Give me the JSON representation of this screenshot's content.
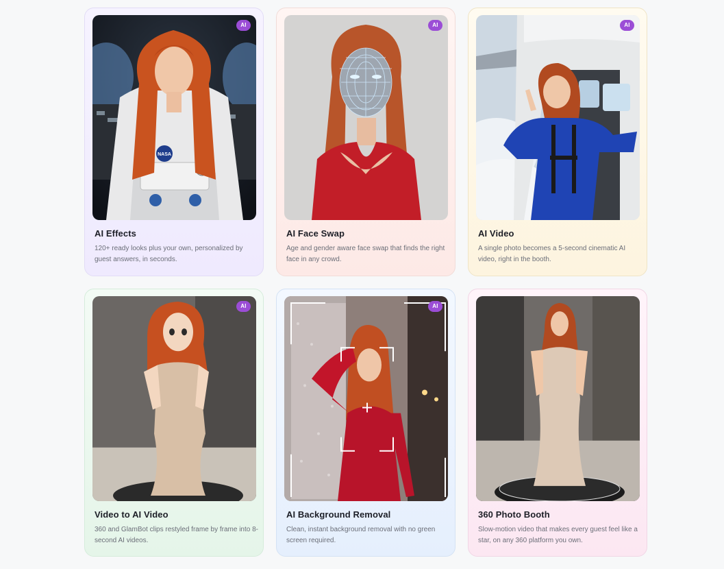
{
  "cards": [
    {
      "title": "AI Effects",
      "description": "120+ ready looks plus your own, personalized by guest answers, in seconds.",
      "badge": "AI"
    },
    {
      "title": "AI Face Swap",
      "description": "Age and gender aware face swap that finds the right face in any crowd.",
      "badge": "AI"
    },
    {
      "title": "AI Video",
      "description": "A single photo becomes a 5-second cinematic AI video, right in the booth.",
      "badge": "AI"
    },
    {
      "title": "Video to AI Video",
      "description": "360 and GlamBot clips restyled frame by frame into 8-second AI videos.",
      "badge": "AI"
    },
    {
      "title": "AI Background Removal",
      "description": "Clean, instant background removal with no green screen required.",
      "badge": "AI"
    },
    {
      "title": "360 Photo Booth",
      "description": "Slow-motion video that makes every guest feel like a star, on any 360 platform you own."
    }
  ],
  "image_labels": {
    "nasa_patch": "NASA"
  },
  "colors": {
    "badge": "#9b4dd6",
    "title": "#1d1f27",
    "description": "#6b6e78",
    "hair": "#c9531f"
  }
}
